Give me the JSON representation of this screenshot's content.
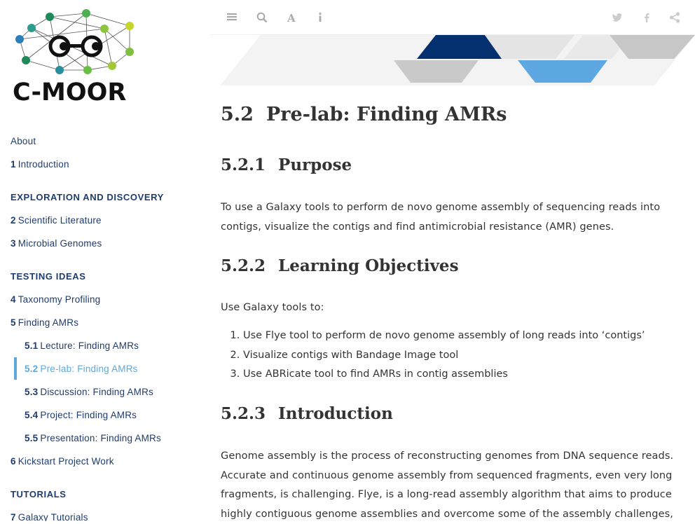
{
  "logo": {
    "text": "C-MOOR"
  },
  "toc": {
    "about": "About",
    "ch1": {
      "num": "1",
      "label": "Introduction"
    },
    "part1": "EXPLORATION AND DISCOVERY",
    "ch2": {
      "num": "2",
      "label": "Scientific Literature"
    },
    "ch3": {
      "num": "3",
      "label": "Microbial Genomes"
    },
    "part2": "TESTING IDEAS",
    "ch4": {
      "num": "4",
      "label": "Taxonomy Profiling"
    },
    "ch5": {
      "num": "5",
      "label": "Finding AMRs"
    },
    "s51": {
      "num": "5.1",
      "label": "Lecture: Finding AMRs"
    },
    "s52": {
      "num": "5.2",
      "label": "Pre-lab: Finding AMRs"
    },
    "s53": {
      "num": "5.3",
      "label": "Discussion: Finding AMRs"
    },
    "s54": {
      "num": "5.4",
      "label": "Project: Finding AMRs"
    },
    "s55": {
      "num": "5.5",
      "label": "Presentation: Finding AMRs"
    },
    "ch6": {
      "num": "6",
      "label": "Kickstart Project Work"
    },
    "part3": "TUTORIALS",
    "ch7": {
      "num": "7",
      "label": "Galaxy Tutorials"
    }
  },
  "toolbar": {
    "left_icons": [
      "list-icon",
      "search-icon",
      "font-icon",
      "info-icon"
    ],
    "right_icons": [
      "twitter-icon",
      "facebook-icon",
      "share-icon"
    ]
  },
  "colors": {
    "nav_text": "#1f3c6e",
    "active": "#5fa8dc",
    "heading": "#333333"
  },
  "main": {
    "title": {
      "num": "5.2",
      "text": "Pre-lab: Finding AMRs"
    },
    "purpose": {
      "num": "5.2.1",
      "heading": "Purpose",
      "text": "To use a Galaxy tools to perform de novo genome assembly of sequencing reads into contigs, visualize the contigs and find antimicrobial resistance (AMR) genes."
    },
    "objectives": {
      "num": "5.2.2",
      "heading": "Learning Objectives",
      "intro": "Use Galaxy tools to:",
      "items": [
        "Use Flye tool to perform de novo genome assembly of long reads into ‘contigs’",
        "Visualize contigs with Bandage Image tool",
        "Use ABRicate tool to find AMRs in contig assemblies"
      ]
    },
    "introduction": {
      "num": "5.2.3",
      "heading": "Introduction",
      "text": "Genome assembly is the process of reconstructing genomes from DNA sequence reads. Accurate and continuous genome assembly from sequenced fragments, even very long fragments, is challenging. Flye, is a long-read assembly algorithm that aims to produce highly contiguous genome assemblies and overcome some of the assembly challenges,"
    }
  }
}
